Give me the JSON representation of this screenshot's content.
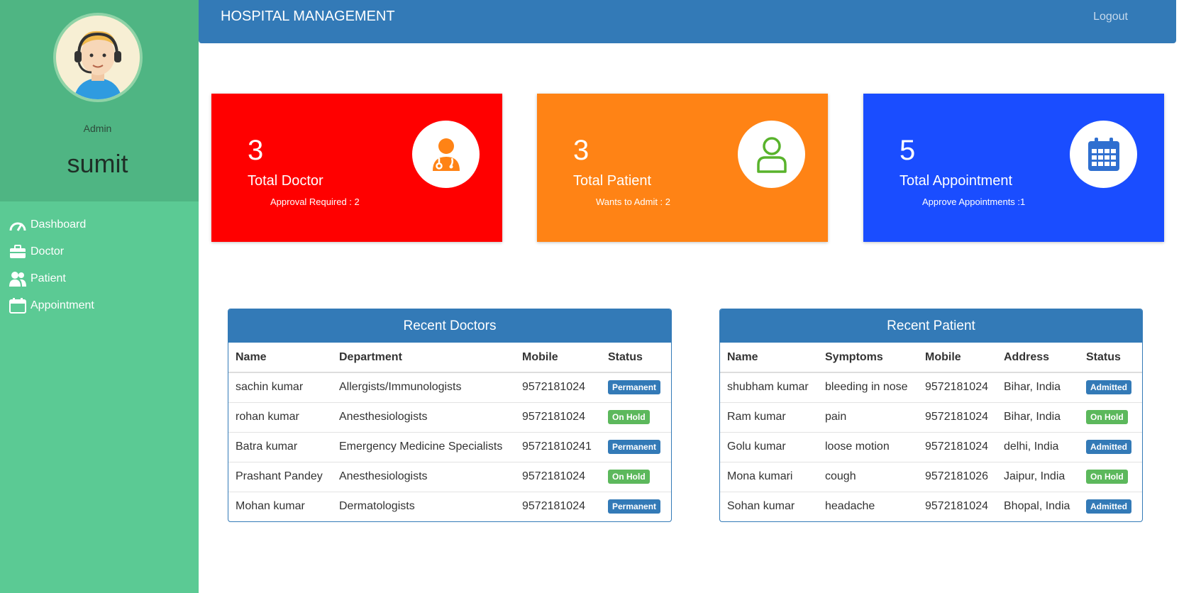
{
  "sidebar": {
    "role": "Admin",
    "username": "sumit",
    "items": [
      {
        "label": "Dashboard",
        "icon": "dashboard-gauge-icon"
      },
      {
        "label": "Doctor",
        "icon": "briefcase-icon"
      },
      {
        "label": "Patient",
        "icon": "users-icon"
      },
      {
        "label": "Appointment",
        "icon": "calendar-icon"
      }
    ]
  },
  "topbar": {
    "brand": "HOSPITAL MANAGEMENT",
    "logout": "Logout"
  },
  "cards": [
    {
      "count": "3",
      "title": "Total Doctor",
      "sub": "Approval Required : 2",
      "color": "#ff0000",
      "icon": "doctor-icon"
    },
    {
      "count": "3",
      "title": "Total Patient",
      "sub": "Wants to Admit : 2",
      "color": "#ff8315",
      "icon": "patient-icon"
    },
    {
      "count": "5",
      "title": "Total Appointment",
      "sub": "Approve Appointments :1",
      "color": "#1a4dff",
      "icon": "calendar-icon"
    }
  ],
  "recent_doctors": {
    "title": "Recent Doctors",
    "columns": [
      "Name",
      "Department",
      "Mobile",
      "Status"
    ],
    "rows": [
      {
        "name": "sachin kumar",
        "department": "Allergists/Immunologists",
        "mobile": "9572181024",
        "status": "Permanent"
      },
      {
        "name": "rohan kumar",
        "department": "Anesthesiologists",
        "mobile": "9572181024",
        "status": "On Hold"
      },
      {
        "name": "Batra kumar",
        "department": "Emergency Medicine Specialists",
        "mobile": "95721810241",
        "status": "Permanent"
      },
      {
        "name": "Prashant Pandey",
        "department": "Anesthesiologists",
        "mobile": "9572181024",
        "status": "On Hold"
      },
      {
        "name": "Mohan kumar",
        "department": "Dermatologists",
        "mobile": "9572181024",
        "status": "Permanent"
      }
    ]
  },
  "recent_patients": {
    "title": "Recent Patient",
    "columns": [
      "Name",
      "Symptoms",
      "Mobile",
      "Address",
      "Status"
    ],
    "rows": [
      {
        "name": "shubham kumar",
        "symptoms": "bleeding in nose",
        "mobile": "9572181024",
        "address": "Bihar, India",
        "status": "Admitted"
      },
      {
        "name": "Ram kumar",
        "symptoms": "pain",
        "mobile": "9572181024",
        "address": "Bihar, India",
        "status": "On Hold"
      },
      {
        "name": "Golu kumar",
        "symptoms": "loose motion",
        "mobile": "9572181024",
        "address": "delhi, India",
        "status": "Admitted"
      },
      {
        "name": "Mona kumari",
        "symptoms": "cough",
        "mobile": "9572181026",
        "address": "Jaipur, India",
        "status": "On Hold"
      },
      {
        "name": "Sohan kumar",
        "symptoms": "headache",
        "mobile": "9572181024",
        "address": "Bhopal, India",
        "status": "Admitted"
      }
    ]
  }
}
